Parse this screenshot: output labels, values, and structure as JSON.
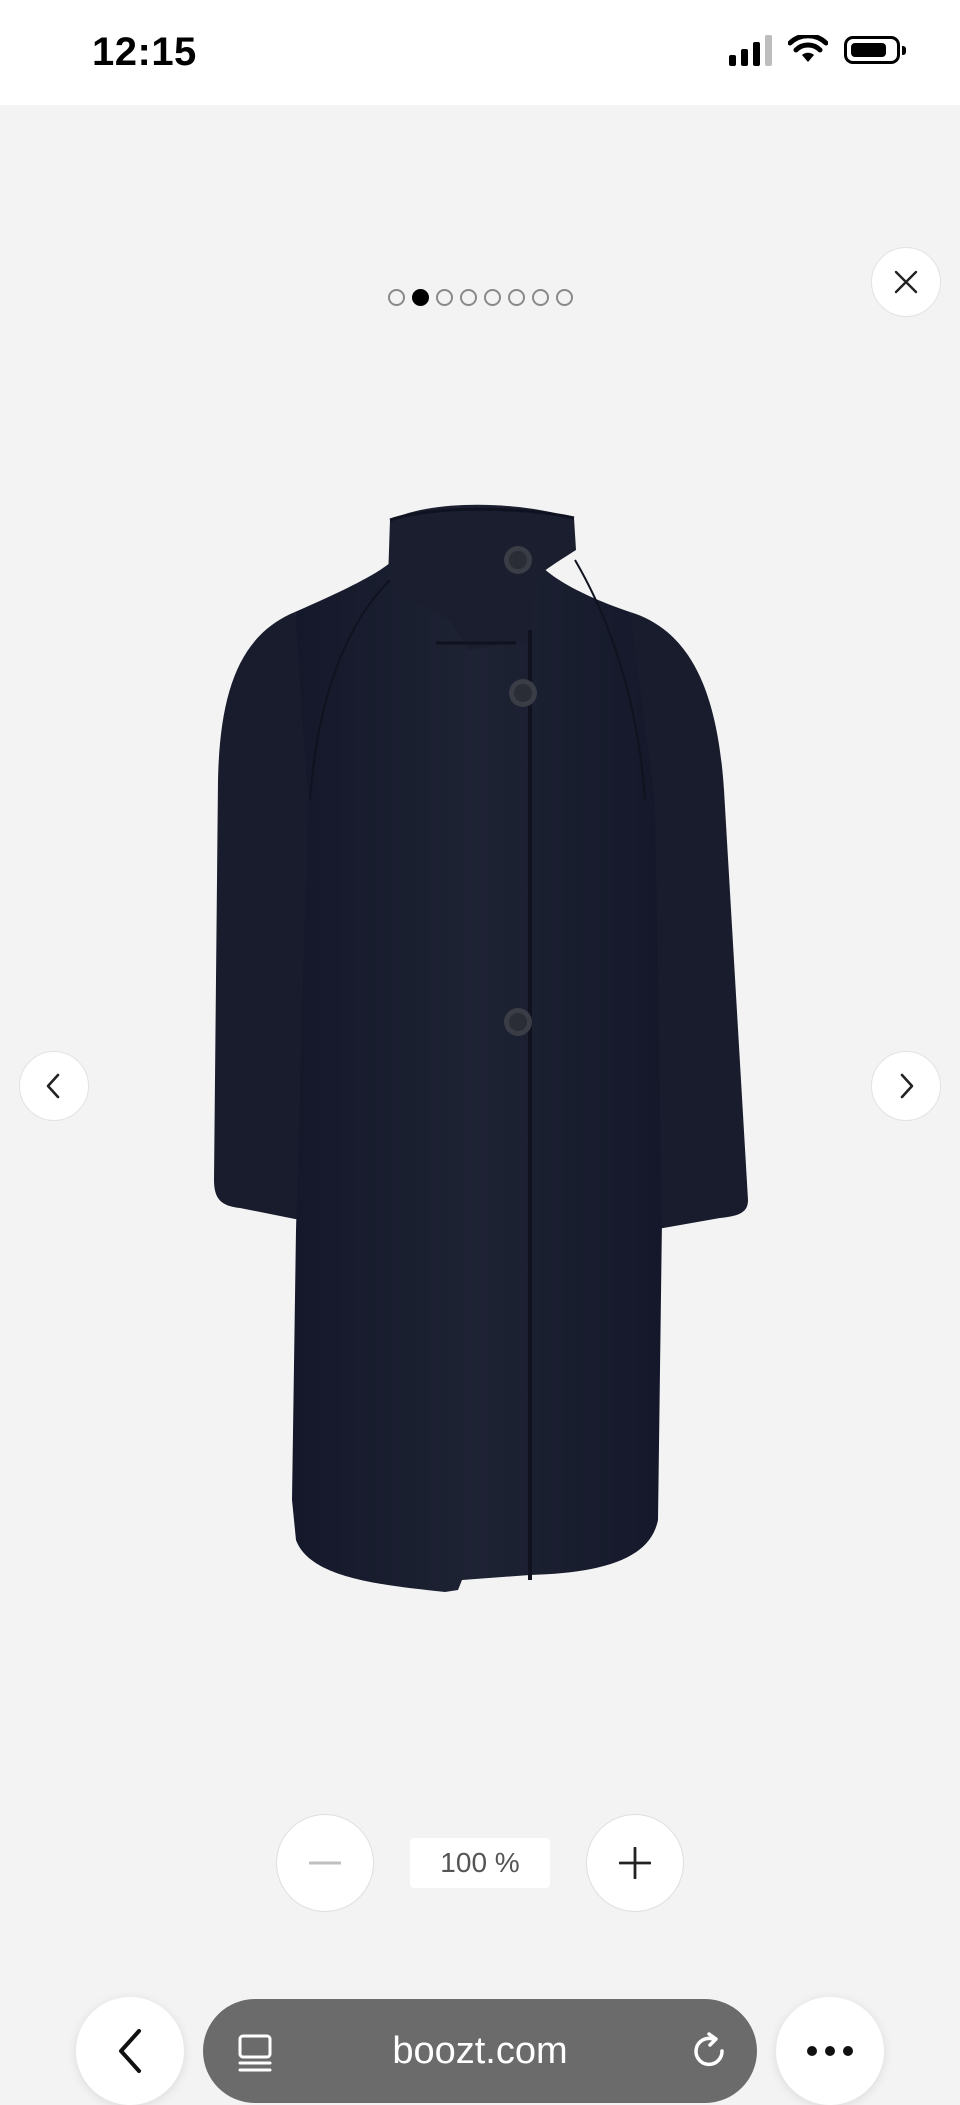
{
  "status_bar": {
    "time": "12:15",
    "icons": [
      "cellular-signal-icon",
      "wifi-icon",
      "battery-icon"
    ]
  },
  "gallery": {
    "image_count": 8,
    "active_index": 1,
    "image_alt": "Navy high-neck wool coat",
    "coat_color": "#1b1f2e"
  },
  "controls": {
    "close_icon": "close-icon",
    "prev_icon": "chevron-left-icon",
    "next_icon": "chevron-right-icon"
  },
  "zoom": {
    "level": "100 %",
    "zoom_out_icon": "minus-icon",
    "zoom_in_icon": "plus-icon"
  },
  "browser": {
    "url": "boozt.com",
    "back_icon": "back-arrow-icon",
    "tabs_icon": "page-tabs-icon",
    "reload_icon": "reload-icon",
    "more_icon": "more-dots-icon"
  }
}
